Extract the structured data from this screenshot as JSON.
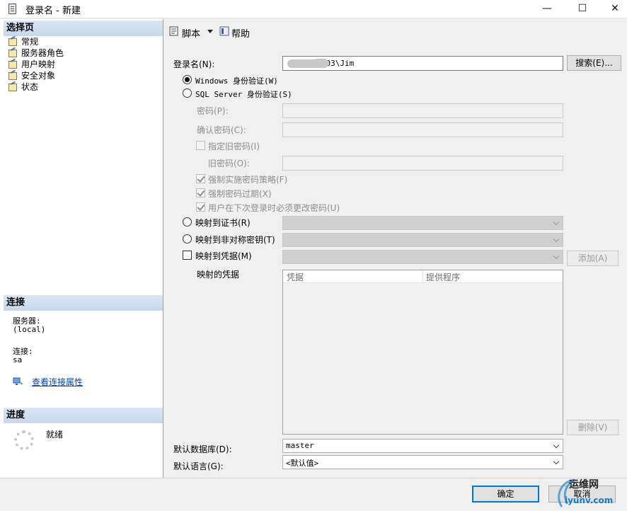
{
  "window": {
    "title": "登录名 - 新建",
    "minimize_glyph": "—",
    "maximize_glyph": "☐",
    "close_glyph": "✕"
  },
  "left_pane": {
    "select_page_header": "选择页",
    "pages": [
      {
        "label": "常规",
        "icon": "page-wrench-icon",
        "selected": true
      },
      {
        "label": "服务器角色",
        "icon": "page-wrench-icon"
      },
      {
        "label": "用户映射",
        "icon": "page-wrench-icon"
      },
      {
        "label": "安全对象",
        "icon": "page-wrench-icon"
      },
      {
        "label": "状态",
        "icon": "page-wrench-icon"
      }
    ],
    "connection_header": "连接",
    "server_label": "服务器:",
    "server_value": "(local)",
    "connection_label": "连接:",
    "connection_value": "sa",
    "view_connection_properties": "查看连接属性",
    "progress_header": "进度",
    "progress_status": "就绪"
  },
  "toolbar": {
    "script_label": "脚本",
    "help_label": "帮助"
  },
  "form": {
    "login_name_label": "登录名(N):",
    "login_name_value": "T     -003\\Jim",
    "search_button": "搜索(E)...",
    "windows_auth_label": "Windows 身份验证(W)",
    "sql_auth_label": "SQL Server 身份验证(S)",
    "password_label": "密码(P):",
    "confirm_password_label": "确认密码(C):",
    "specify_old_password_label": "指定旧密码(I)",
    "old_password_label": "旧密码(O):",
    "enforce_policy_label": "强制实施密码策略(F)",
    "enforce_expiration_label": "强制密码过期(X)",
    "must_change_label": "用户在下次登录时必须更改密码(U)",
    "map_certificate_label": "映射到证书(R)",
    "map_asym_key_label": "映射到非对称密钥(T)",
    "map_credential_label": "映射到凭据(M)",
    "add_button": "添加(A)",
    "mapped_credentials_label": "映射的凭据",
    "cred_col_credential": "凭据",
    "cred_col_provider": "提供程序",
    "remove_button": "删除(V)",
    "default_database_label": "默认数据库(D):",
    "default_database_value": "master",
    "default_language_label": "默认语言(G):",
    "default_language_value": "<默认值>"
  },
  "footer": {
    "ok_button": "确定",
    "cancel_button": "取消"
  },
  "watermark": {
    "name": "运维网",
    "url": "iyunv.com"
  },
  "colors": {
    "section_header": "#c8d7ea",
    "link": "#0645ad",
    "primary_border": "#0078d7",
    "disabled_text": "#8c8c8c"
  }
}
